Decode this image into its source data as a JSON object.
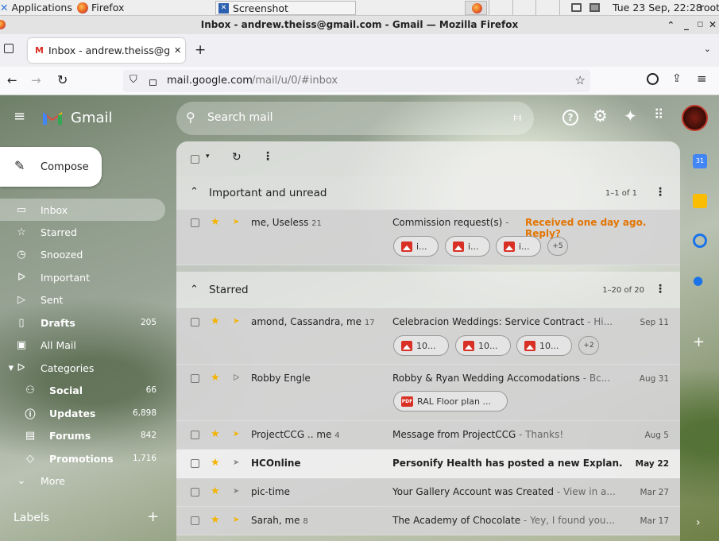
{
  "taskbar": {
    "applications": "Applications",
    "firefox": "Firefox",
    "screenshot": "Screenshot",
    "datetime": "Tue 23 Sep, 22:28",
    "user": "root",
    "badge": "3"
  },
  "window": {
    "title": "Inbox - andrew.theiss@gmail.com - Gmail — Mozilla Firefox"
  },
  "tab": {
    "label": "Inbox - andrew.theiss@gr",
    "new": "+"
  },
  "url": {
    "domain": "mail.google.com",
    "path": "/mail/u/0/#inbox"
  },
  "gmail": {
    "logo": "Gmail",
    "search_placeholder": "Search mail",
    "compose": "Compose",
    "sidebar": [
      {
        "label": "Inbox",
        "count": ""
      },
      {
        "label": "Starred",
        "count": ""
      },
      {
        "label": "Snoozed",
        "count": ""
      },
      {
        "label": "Important",
        "count": ""
      },
      {
        "label": "Sent",
        "count": ""
      },
      {
        "label": "Drafts",
        "count": "205"
      },
      {
        "label": "All Mail",
        "count": ""
      },
      {
        "label": "Categories",
        "count": ""
      },
      {
        "label": "Social",
        "count": "66"
      },
      {
        "label": "Updates",
        "count": "6,898"
      },
      {
        "label": "Forums",
        "count": "842"
      },
      {
        "label": "Promotions",
        "count": "1,716"
      },
      {
        "label": "More",
        "count": ""
      }
    ],
    "labels_heading": "Labels",
    "sections": {
      "important": {
        "title": "Important and unread",
        "range": "1–1 of 1"
      },
      "starred": {
        "title": "Starred",
        "range": "1–20 of 20"
      }
    },
    "emails": [
      {
        "sender": "me, Useless",
        "count": "21",
        "subject": "Commission request(s)",
        "snippet": " - ",
        "highlight": "Received one day ago. Reply?",
        "date": "",
        "chips": [
          "i...",
          "i...",
          "i..."
        ],
        "more": "+5"
      },
      {
        "sender": "amond, Cassandra, me",
        "count": "17",
        "subject": "Celebracion Weddings: Service Contract",
        "snippet": " - Hi...",
        "date": "Sep 11",
        "chips": [
          "10...",
          "10...",
          "10..."
        ],
        "more": "+2"
      },
      {
        "sender": "Robby Engle",
        "count": "",
        "subject": "Robby & Ryan Wedding Accomodations",
        "snippet": " - Bc...",
        "date": "Aug 31",
        "chips": [
          "RAL Floor plan ..."
        ],
        "more": ""
      },
      {
        "sender": "ProjectCCG .. me",
        "count": "4",
        "subject": "Message from ProjectCCG",
        "snippet": " - Thanks!",
        "date": "Aug 5"
      },
      {
        "sender": "HCOnline",
        "count": "",
        "subject": "Personify Health has posted a new Explan...",
        "snippet": "",
        "date": "May 22"
      },
      {
        "sender": "pic-time",
        "count": "",
        "subject": "Your Gallery Account was Created",
        "snippet": " - View in a...",
        "date": "Mar 27"
      },
      {
        "sender": "Sarah, me",
        "count": "8",
        "subject": "The Academy of Chocolate",
        "snippet": " - Yey, I found you...",
        "date": "Mar 17"
      }
    ]
  }
}
